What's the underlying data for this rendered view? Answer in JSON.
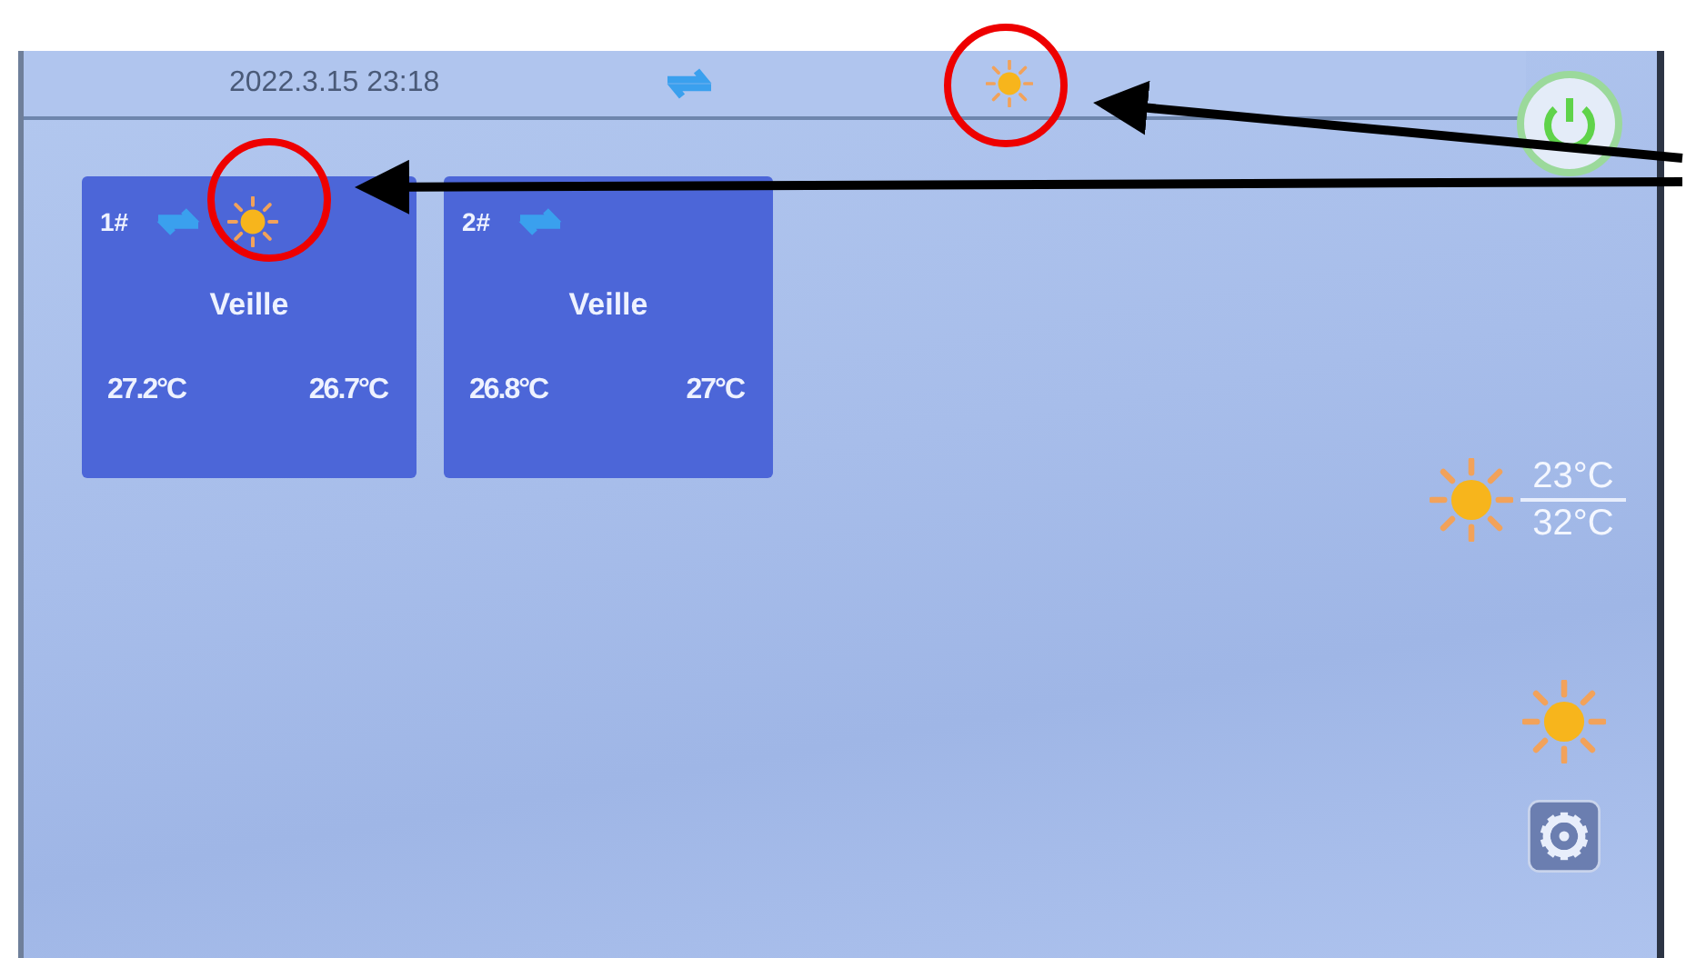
{
  "status_bar": {
    "datetime": "2022.3.15 23:18",
    "sync_icon": true,
    "sun_icon": true
  },
  "units": [
    {
      "number": "1#",
      "sun_icon": true,
      "mode": "Veille",
      "temp_1": "27.2°C",
      "temp_2": "26.7°C"
    },
    {
      "number": "2#",
      "sun_icon": false,
      "mode": "Veille",
      "temp_1": "26.8°C",
      "temp_2": "27°C"
    }
  ],
  "forecast": {
    "low": "23°C",
    "high": "32°C"
  }
}
